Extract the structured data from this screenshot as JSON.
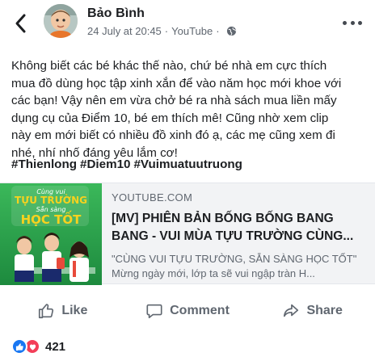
{
  "header": {
    "author": "Bảo Bình",
    "date": "24 July at 20:45",
    "source": "YouTube",
    "icons": [
      "back-chevron-icon",
      "avatar",
      "globe-icon",
      "more-dots-icon"
    ]
  },
  "post": {
    "lines": [
      "Không biết các bé khác thế nào, chứ bé nhà em cực thích",
      "mua đồ dùng học tập xinh xắn để vào năm học mới khoe với",
      "các bạn! Vậy nên em vừa chở bé ra nhà sách mua liền mấy",
      "dụng cụ của Điểm 10, bé em thích mê! Cũng nhờ xem clip",
      "này em mới biết có nhiều đồ xinh đó ạ, các mẹ cũng xem đi",
      "nhé, nhí nhố đáng yêu lắm cơ!"
    ],
    "hashtags": [
      "#Thienlong",
      "#Diem10",
      "#Vuimuatuutruong"
    ]
  },
  "link": {
    "domain": "YOUTUBE.COM",
    "title": "[MV] PHIÊN BẢN BỐNG BỐNG BANG BANG - VUI MÙA TỰU TRƯỜNG CÙNG...",
    "description": "\"CÙNG VUI TỰU TRƯỜNG, SẴN SÀNG HỌC TỐT\" Mừng ngày mới, lớp ta sẽ vui ngập tràn H...",
    "thumb": {
      "line1": "Cùng vui",
      "line2": "TỰU TRƯỜNG",
      "line3": "Sẵn sàng",
      "line4": "HỌC TỐT"
    }
  },
  "actions": {
    "like": "Like",
    "comment": "Comment",
    "share": "Share"
  },
  "reactions": {
    "count": "421",
    "types": [
      "like-reaction-icon",
      "love-reaction-icon"
    ]
  },
  "colors": {
    "text": "#1c1e21",
    "secondary": "#606770",
    "card_bg": "#f2f3f5",
    "like_blue": "#1877f2",
    "love_red": "#f33e58",
    "thumb_green": "#2fa84f",
    "thumb_yellow": "#f7d21e"
  }
}
